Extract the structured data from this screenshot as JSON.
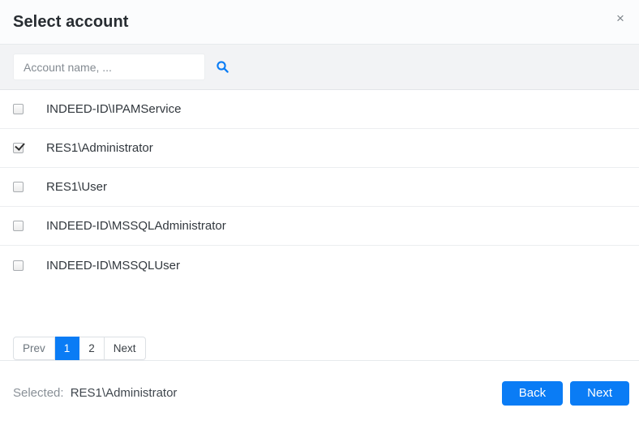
{
  "dialog": {
    "title": "Select account"
  },
  "icons": {
    "close": "×",
    "search": "magnifier"
  },
  "search": {
    "placeholder": "Account name, ...",
    "value": ""
  },
  "accounts": [
    {
      "name": "INDEED-ID\\IPAMService",
      "checked": false
    },
    {
      "name": "RES1\\Administrator",
      "checked": true
    },
    {
      "name": "RES1\\User",
      "checked": false
    },
    {
      "name": "INDEED-ID\\MSSQLAdministrator",
      "checked": false
    },
    {
      "name": "INDEED-ID\\MSSQLUser",
      "checked": false
    }
  ],
  "pagination": {
    "prev_label": "Prev",
    "pages": [
      "1",
      "2"
    ],
    "active_page": "1",
    "next_label": "Next"
  },
  "footer": {
    "selected_label": "Selected:",
    "selected_value": "RES1\\Administrator",
    "back_label": "Back",
    "next_label": "Next"
  },
  "colors": {
    "primary": "#0a7cf5",
    "header-bg": "#fbfcfd",
    "toolbar-bg": "#f2f3f5",
    "border": "#e7eaed",
    "text": "#32383e",
    "muted": "#868e96"
  }
}
